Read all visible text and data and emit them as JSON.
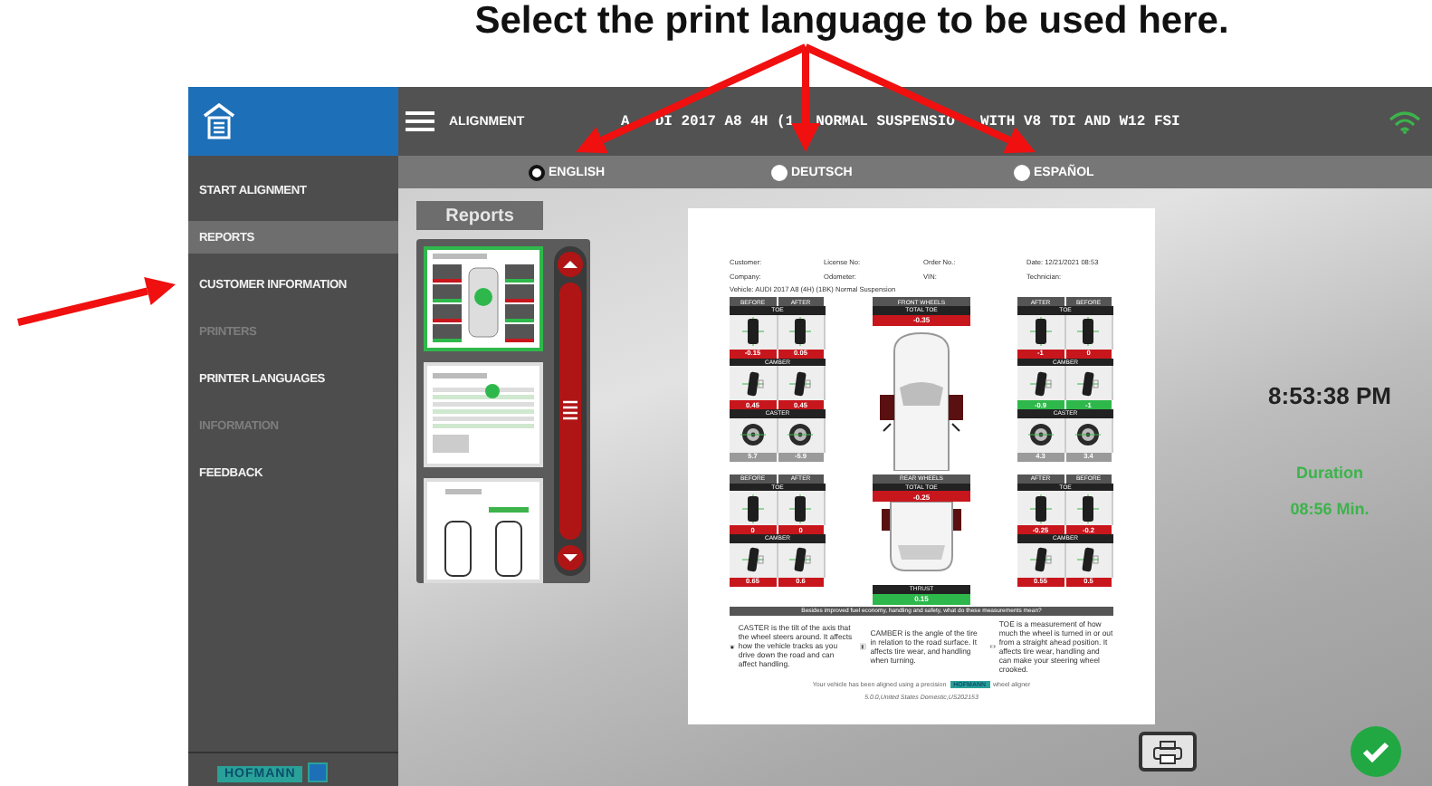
{
  "annotation": {
    "caption": "Select the print language to be used here."
  },
  "sidebar": {
    "items": [
      {
        "label": "START ALIGNMENT",
        "selected": false,
        "disabled": false
      },
      {
        "label": "REPORTS",
        "selected": true,
        "disabled": false
      },
      {
        "label": "CUSTOMER INFORMATION",
        "selected": false,
        "disabled": false
      },
      {
        "label": "PRINTERS",
        "selected": false,
        "disabled": true
      },
      {
        "label": "PRINTER LANGUAGES",
        "selected": false,
        "disabled": false
      },
      {
        "label": "INFORMATION",
        "selected": false,
        "disabled": true
      },
      {
        "label": "FEEDBACK",
        "selected": false,
        "disabled": false
      }
    ],
    "brand": "HOFMANN"
  },
  "header": {
    "menu_label": "ALIGNMENT",
    "vehicle_title_parts": [
      "A",
      "DI 2017 A8 4H (1",
      "NORMAL SUSPENSIO",
      "WITH V8 TDI AND W12 FSI"
    ]
  },
  "languages": [
    {
      "label": "ENGLISH",
      "selected": true
    },
    {
      "label": "DEUTSCH",
      "selected": false
    },
    {
      "label": "ESPAÑOL",
      "selected": false
    }
  ],
  "reports": {
    "title": "Reports",
    "thumbnails": [
      {
        "kind": "alignment",
        "selected": true
      },
      {
        "kind": "table",
        "selected": false
      },
      {
        "kind": "diagram",
        "selected": false
      }
    ]
  },
  "report": {
    "fields": [
      [
        "Customer:",
        "License No:",
        "Order No.:",
        "Date: 12/21/2021 08:53"
      ],
      [
        "Company:",
        "Odometer:",
        "VIN:",
        "Technician:"
      ]
    ],
    "vehicle": "Vehicle: AUDI 2017 A8 (4H) (1BK) Normal Suspension",
    "front": {
      "title": "FRONT WHEELS",
      "total_label": "TOTAL TOE",
      "total": {
        "value": "-0.35",
        "color": "#c8161d"
      },
      "left_headers": [
        "BEFORE",
        "AFTER"
      ],
      "right_headers": [
        "AFTER",
        "BEFORE"
      ],
      "rows": [
        {
          "kind": "toe",
          "left": {
            "label": "TOE",
            "cells": [
              {
                "value": "-0.15",
                "color": "#c8161d"
              },
              {
                "value": "0.05",
                "color": "#c8161d"
              }
            ]
          },
          "right": {
            "label": "TOE",
            "cells": [
              {
                "value": "-1",
                "color": "#c8161d"
              },
              {
                "value": "0",
                "color": "#c8161d"
              }
            ]
          }
        },
        {
          "kind": "camber",
          "left": {
            "label": "CAMBER",
            "cells": [
              {
                "value": "0.45",
                "color": "#c8161d"
              },
              {
                "value": "0.45",
                "color": "#c8161d"
              }
            ]
          },
          "right": {
            "label": "CAMBER",
            "cells": [
              {
                "value": "-0.9",
                "color": "#2eb84b"
              },
              {
                "value": "-1",
                "color": "#2eb84b"
              }
            ]
          }
        },
        {
          "kind": "caster",
          "left": {
            "label": "CASTER",
            "cells": [
              {
                "value": "5.7",
                "color": "#9a9a9a"
              },
              {
                "value": "-5.9",
                "color": "#9a9a9a"
              }
            ]
          },
          "right": {
            "label": "CASTER",
            "cells": [
              {
                "value": "4.3",
                "color": "#9a9a9a"
              },
              {
                "value": "3.4",
                "color": "#9a9a9a"
              }
            ]
          }
        }
      ]
    },
    "rear": {
      "title": "REAR WHEELS",
      "total_label": "TOTAL TOE",
      "total": {
        "value": "-0.25",
        "color": "#c8161d"
      },
      "left_headers": [
        "BEFORE",
        "AFTER"
      ],
      "right_headers": [
        "AFTER",
        "BEFORE"
      ],
      "rows": [
        {
          "kind": "toe",
          "left": {
            "label": "TOE",
            "cells": [
              {
                "value": "0",
                "color": "#c8161d"
              },
              {
                "value": "0",
                "color": "#c8161d"
              }
            ]
          },
          "right": {
            "label": "TOE",
            "cells": [
              {
                "value": "-0.25",
                "color": "#c8161d"
              },
              {
                "value": "-0.2",
                "color": "#c8161d"
              }
            ]
          }
        },
        {
          "kind": "camber",
          "left": {
            "label": "CAMBER",
            "cells": [
              {
                "value": "0.65",
                "color": "#c8161d"
              },
              {
                "value": "0.6",
                "color": "#c8161d"
              }
            ]
          },
          "right": {
            "label": "CAMBER",
            "cells": [
              {
                "value": "0.55",
                "color": "#c8161d"
              },
              {
                "value": "0.5",
                "color": "#c8161d"
              }
            ]
          }
        }
      ],
      "thrust": {
        "label": "THRUST",
        "value": "0.15",
        "color": "#2eb84b"
      }
    },
    "banner": "Besides improved fuel economy, handling and safety, what do these measurements mean?",
    "explanations": [
      {
        "kind": "caster",
        "text": "CASTER is the tilt of the axis that the wheel steers around. It affects how the vehicle tracks as you drive down the road and can affect handling."
      },
      {
        "kind": "camber",
        "text": "CAMBER is the angle of the tire in relation to the road surface. It affects tire wear, and handling when turning."
      },
      {
        "kind": "toe",
        "text": "TOE is a measurement of how much the wheel is turned in or out from a straight ahead position. It affects tire wear, handling and can make your steering wheel crooked."
      }
    ],
    "footer_text": "Your vehicle has been aligned using a precision",
    "footer_brand": "HOFMANN",
    "footer_suffix": "wheel aligner",
    "version": "5.0.0,United States Domestic,US202153"
  },
  "clock": {
    "time": "8:53:38 PM",
    "duration_label": "Duration",
    "duration": "08:56 Min."
  }
}
